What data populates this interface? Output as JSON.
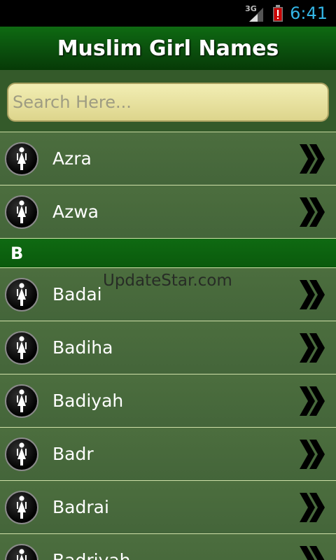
{
  "status": {
    "network": "3G",
    "time": "6:41"
  },
  "header": {
    "title": "Muslim Girl Names"
  },
  "search": {
    "placeholder": "Search Here..."
  },
  "list": {
    "top_items": [
      {
        "name": "Azra"
      },
      {
        "name": "Azwa"
      }
    ],
    "section_b": {
      "header": "B",
      "items": [
        {
          "name": "Badai"
        },
        {
          "name": "Badiha"
        },
        {
          "name": "Badiyah"
        },
        {
          "name": "Badr"
        },
        {
          "name": "Badrai"
        },
        {
          "name": "Badriyah"
        }
      ]
    }
  },
  "watermark": "UpdateStar.com",
  "icons": {
    "avatar": "female-figure-icon",
    "chevron": "double-chevron-right-icon"
  },
  "colors": {
    "accent": "#33b5e5",
    "header_green": "#0a4a0c",
    "row_green": "#4c6e3e"
  }
}
